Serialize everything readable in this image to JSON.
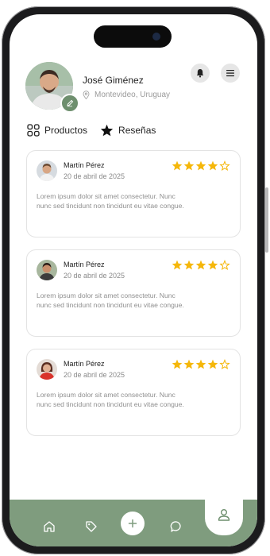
{
  "profile": {
    "name": "José Giménez",
    "location": "Montevideo, Uruguay"
  },
  "tabs": [
    {
      "label": "Productos",
      "icon": "grid-icon"
    },
    {
      "label": "Reseñas",
      "icon": "star-icon",
      "active": true
    }
  ],
  "reviews": [
    {
      "author": "Martín Pérez",
      "date": "20 de abril de 2025",
      "rating": 4,
      "max": 5,
      "text": "Lorem ipsum dolor sit amet consectetur. Nunc nunc sed tincidunt non tincidunt eu vitae congue."
    },
    {
      "author": "Martín Pérez",
      "date": "20 de abril de 2025",
      "rating": 4,
      "max": 5,
      "text": "Lorem ipsum dolor sit amet consectetur. Nunc nunc sed tincidunt non tincidunt eu vitae congue."
    },
    {
      "author": "Martín Pérez",
      "date": "20 de abril de 2025",
      "rating": 4,
      "max": 5,
      "text": "Lorem ipsum dolor sit amet consectetur. Nunc nunc sed tincidunt non tincidunt eu vitae congue."
    }
  ],
  "nav": [
    "home-icon",
    "tag-icon",
    "plus-icon",
    "chat-icon",
    "user-icon"
  ],
  "colors": {
    "accent": "#7f9c7e",
    "star": "#f5b70a",
    "text": "#222222",
    "muted": "#8f8f8f"
  }
}
